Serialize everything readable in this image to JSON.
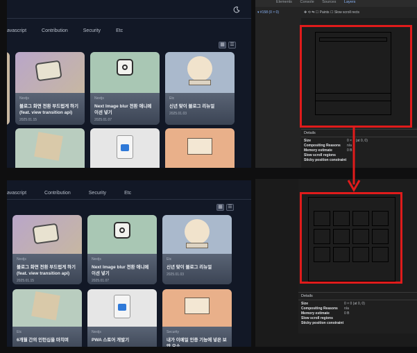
{
  "top_panel": {
    "nav": [
      "avascript",
      "Contribution",
      "Security",
      "Etc"
    ],
    "moon_icon": "moon-icon",
    "cards": [
      {
        "category": "Nextjs",
        "title": "블로그 화면 전환 부드럽게 하기 (feat. view transition api)",
        "date": "2025.01.15"
      },
      {
        "category": "Nextjs",
        "title": "Next Image blur 전환 애니메이션 넣기",
        "date": "2025.01.07"
      },
      {
        "category": "Etc",
        "title": "신년 맞이 블로그 리뉴얼",
        "date": "2025.01.03"
      }
    ]
  },
  "bottom_panel": {
    "nav": [
      "avascript",
      "Contribution",
      "Security",
      "Etc"
    ],
    "cards": [
      {
        "category": "Nextjs",
        "title": "블로그 화면 전환 부드럽게 하기 (feat. view transition api)",
        "date": "2025.01.15"
      },
      {
        "category": "Nextjs",
        "title": "Next Image blur 전환 애니메이션 넣기",
        "date": "2025.01.07"
      },
      {
        "category": "Etc",
        "title": "신년 맞이 블로그 리뉴얼",
        "date": "2025.01.03"
      },
      {
        "category": "Etc",
        "title": "6개월 간의 인턴십을 마치며",
        "date": ""
      },
      {
        "category": "Nextjs",
        "title": "PWA 스토어 개발기",
        "date": ""
      },
      {
        "category": "Security",
        "title": "내가 이메일 인증 기능에 넣은 보안 요소",
        "date": ""
      }
    ]
  },
  "devtools": {
    "tabs": [
      "Elements",
      "Console",
      "Sources",
      "Layers"
    ],
    "tree_item": "▾ #158 (0 × 0)",
    "toolbar": {
      "paints": "Paints",
      "slow_scroll": "Slow scroll rects"
    },
    "details_header": "Details",
    "details_rows_top": [
      {
        "k": "Size",
        "v": "0 × 0 (at 0, 0)"
      },
      {
        "k": "Compositing Reasons",
        "v": "n/a"
      },
      {
        "k": "Memory estimate",
        "v": "0 B"
      },
      {
        "k": "Slow scroll regions",
        "v": ""
      },
      {
        "k": "Sticky position constraint",
        "v": ""
      }
    ],
    "details_rows_bottom": [
      {
        "k": "Size",
        "v": "0 × 0 (at 0, 0)"
      },
      {
        "k": "Compositing Reasons",
        "v": "n/a"
      },
      {
        "k": "Memory estimate",
        "v": "0 B"
      },
      {
        "k": "Slow scroll regions",
        "v": ""
      },
      {
        "k": "Sticky position constraint",
        "v": ""
      }
    ]
  },
  "colors": {
    "highlight": "#e01b1b",
    "bg": "#121826"
  }
}
